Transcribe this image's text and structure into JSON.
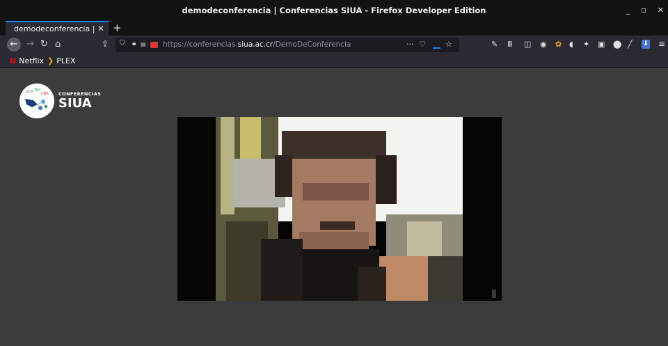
{
  "window": {
    "title": "demodeconferencia | Conferencias SIUA - Firefox Developer Edition",
    "minimize_glyph": "_",
    "maximize_glyph": "▫",
    "close_glyph": "✕"
  },
  "tabs": [
    {
      "label": "demodeconferencia | Co",
      "close_glyph": "✕"
    }
  ],
  "new_tab_glyph": "+",
  "navbar": {
    "url_prefix": "https://conferencias.",
    "url_domain": "siua.ac.cr",
    "url_path": "/DemoDeConferencia",
    "page_actions_glyph": "···",
    "icons": [
      "back-icon",
      "forward-icon",
      "reload-icon",
      "home-icon",
      "bookmark-up-icon",
      "shield-icon",
      "lock-icon",
      "permissions-icon",
      "pocket-icon",
      "star-icon",
      "wrench-icon",
      "library-icon",
      "sidebar-icon",
      "extension-icons",
      "download-icon",
      "menu-icon"
    ]
  },
  "bookmarks": [
    {
      "label": "Netflix",
      "icon": "netflix-icon",
      "color": "#e50914"
    },
    {
      "label": "PLEX",
      "icon": "plex-icon",
      "color": "#e5a00d"
    }
  ],
  "logo": {
    "top_text": "CONFERENCIAS",
    "main_text": "SIUA"
  },
  "colors": {
    "tab_accent": "#0a84ff",
    "page_background": "#3c3c3c",
    "toolbar": "#2b2a33"
  }
}
